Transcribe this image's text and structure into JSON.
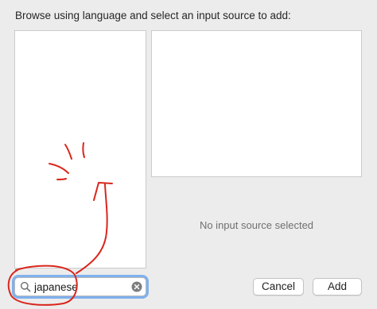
{
  "dialog": {
    "heading": "Browse using language and select an input source to add:",
    "empty_message": "No input source selected"
  },
  "search": {
    "value": "japanese",
    "icon": "search-icon",
    "clear_icon": "clear-icon"
  },
  "buttons": {
    "cancel": "Cancel",
    "add": "Add"
  },
  "colors": {
    "background": "#ececec",
    "focus_ring": "#7fb1ee",
    "annotation": "#d9261c"
  }
}
